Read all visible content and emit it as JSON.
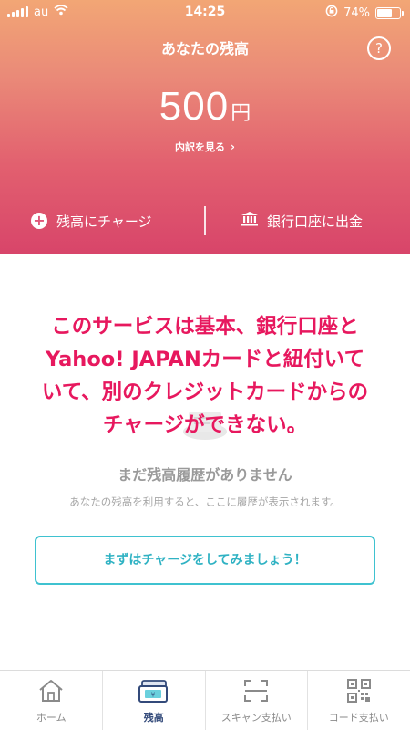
{
  "status_bar": {
    "carrier": "au",
    "time": "14:25",
    "battery": "74%",
    "battery_level": 0.74
  },
  "header": {
    "title": "あなたの残高",
    "help_icon": "?",
    "balance_amount": "500",
    "balance_unit": "円",
    "breakdown_link": "内訳を見る",
    "breakdown_chevron": "›",
    "charge_label": "残高にチャージ",
    "withdraw_label": "銀行口座に出金"
  },
  "overlay_text": {
    "line1": "このサービスは基本、銀行口座と",
    "line2": "Yahoo! JAPANカードと紐付いて",
    "line3": "いて、別のクレジットカードからの",
    "line4": "チャージができない。"
  },
  "empty_state": {
    "title": "まだ残高履歴がありません",
    "subtitle": "あなたの残高を利用すると、ここに履歴が表示されます。",
    "cta_label": "まずはチャージをしてみましょう！"
  },
  "tabs": [
    {
      "label": "ホーム",
      "icon": "home-icon",
      "active": false
    },
    {
      "label": "残高",
      "icon": "wallet-icon",
      "active": true
    },
    {
      "label": "スキャン支払い",
      "icon": "scan-icon",
      "active": false
    },
    {
      "label": "コード支払い",
      "icon": "qr-code-icon",
      "active": false
    }
  ],
  "colors": {
    "header_top": "#f2a675",
    "header_bottom": "#d8456a",
    "overlay_text": "#e7185e",
    "cta_border": "#3fc2d0",
    "tab_active": "#334a7a"
  }
}
